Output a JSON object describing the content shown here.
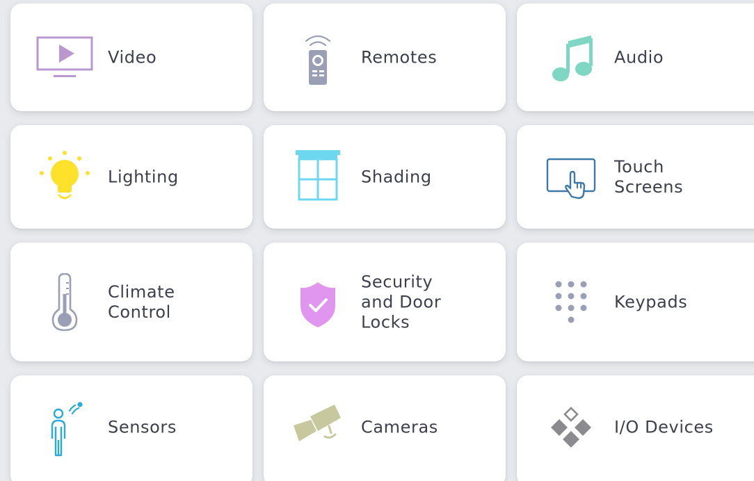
{
  "tiles": [
    {
      "label": "Video",
      "icon": "tv-play-icon",
      "color": "#b898cf"
    },
    {
      "label": "Remotes",
      "icon": "remote-control-icon",
      "color": "#9a9fb5"
    },
    {
      "label": "Audio",
      "icon": "music-note-icon",
      "color": "#7fd6c2"
    },
    {
      "label": "Lighting",
      "icon": "light-bulb-icon",
      "color": "#fde12a"
    },
    {
      "label": "Shading",
      "icon": "window-shade-icon",
      "color": "#6dd7f0"
    },
    {
      "label": "Touch\nScreens",
      "icon": "touch-screen-icon",
      "color": "#3d79a8"
    },
    {
      "label": "Climate\nControl",
      "icon": "thermometer-icon",
      "color": "#9a9fb5"
    },
    {
      "label": "Security\nand Door\nLocks",
      "icon": "shield-check-icon",
      "color": "#e096ef"
    },
    {
      "label": "Keypads",
      "icon": "keypad-icon",
      "color": "#9a9fb5"
    },
    {
      "label": "Sensors",
      "icon": "person-sensor-icon",
      "color": "#29a9dd"
    },
    {
      "label": "Cameras",
      "icon": "security-camera-icon",
      "color": "#c8c89e"
    },
    {
      "label": "I/O Devices",
      "icon": "io-diamond-icon",
      "color": "#8b8b8f"
    }
  ]
}
